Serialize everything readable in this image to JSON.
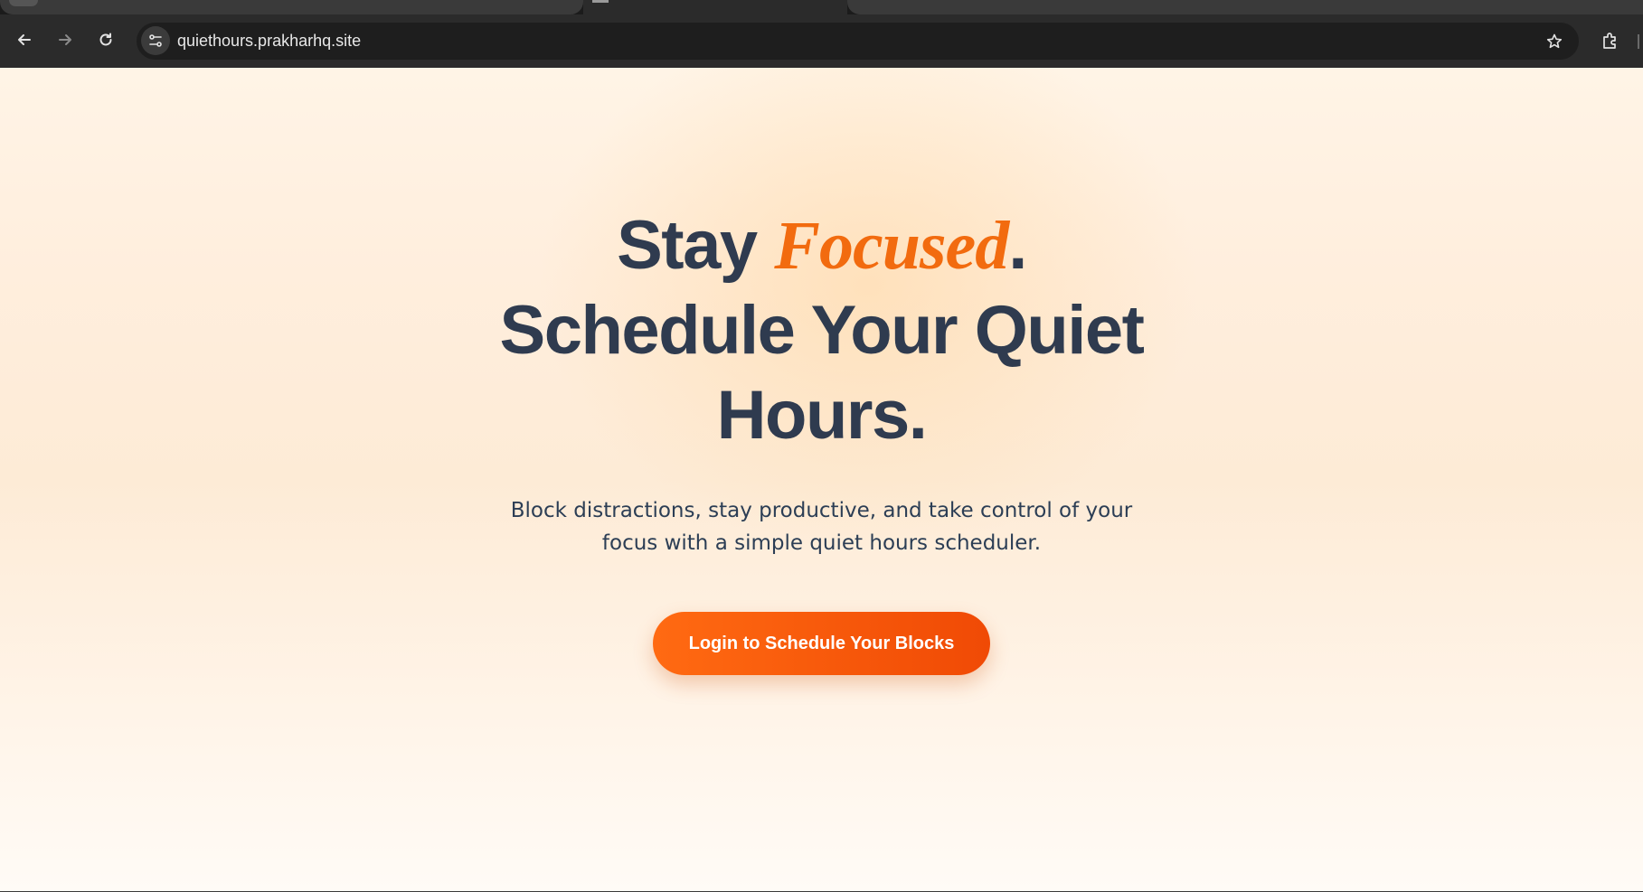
{
  "browser": {
    "address_bar": {
      "url": "quiethours.prakharhq.site"
    },
    "icons": {
      "back": "arrow-left-icon",
      "forward": "arrow-right-icon",
      "reload": "reload-icon",
      "site_info": "tune-icon",
      "bookmark": "star-icon",
      "extensions": "puzzle-icon"
    }
  },
  "hero": {
    "title_part1": "Stay ",
    "title_accent": "Focused",
    "title_part2": ".",
    "title_line2": "Schedule Your Quiet",
    "title_line3": "Hours.",
    "subtitle": "Block distractions, stay productive, and take control of your focus with a simple quiet hours scheduler.",
    "cta_label": "Login to Schedule Your Blocks"
  },
  "colors": {
    "heading": "#2f3b4f",
    "accent": "#f26b0f",
    "cta_start": "#ff6a12",
    "cta_end": "#f04a05",
    "background": "#fff4e6"
  }
}
